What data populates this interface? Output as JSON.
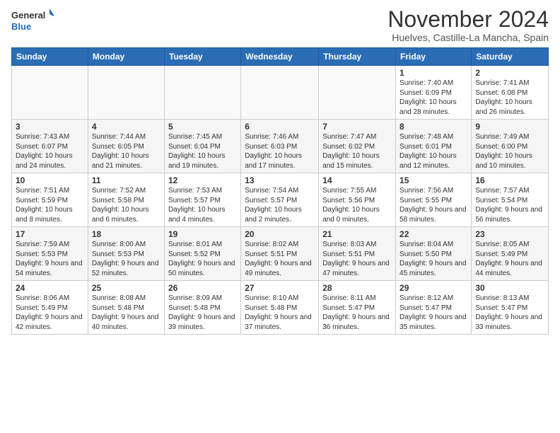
{
  "header": {
    "logo_general": "General",
    "logo_blue": "Blue",
    "month_title": "November 2024",
    "location": "Huelves, Castille-La Mancha, Spain"
  },
  "weekdays": [
    "Sunday",
    "Monday",
    "Tuesday",
    "Wednesday",
    "Thursday",
    "Friday",
    "Saturday"
  ],
  "weeks": [
    [
      {
        "day": "",
        "info": ""
      },
      {
        "day": "",
        "info": ""
      },
      {
        "day": "",
        "info": ""
      },
      {
        "day": "",
        "info": ""
      },
      {
        "day": "",
        "info": ""
      },
      {
        "day": "1",
        "info": "Sunrise: 7:40 AM\nSunset: 6:09 PM\nDaylight: 10 hours and 28 minutes."
      },
      {
        "day": "2",
        "info": "Sunrise: 7:41 AM\nSunset: 6:08 PM\nDaylight: 10 hours and 26 minutes."
      }
    ],
    [
      {
        "day": "3",
        "info": "Sunrise: 7:43 AM\nSunset: 6:07 PM\nDaylight: 10 hours and 24 minutes."
      },
      {
        "day": "4",
        "info": "Sunrise: 7:44 AM\nSunset: 6:05 PM\nDaylight: 10 hours and 21 minutes."
      },
      {
        "day": "5",
        "info": "Sunrise: 7:45 AM\nSunset: 6:04 PM\nDaylight: 10 hours and 19 minutes."
      },
      {
        "day": "6",
        "info": "Sunrise: 7:46 AM\nSunset: 6:03 PM\nDaylight: 10 hours and 17 minutes."
      },
      {
        "day": "7",
        "info": "Sunrise: 7:47 AM\nSunset: 6:02 PM\nDaylight: 10 hours and 15 minutes."
      },
      {
        "day": "8",
        "info": "Sunrise: 7:48 AM\nSunset: 6:01 PM\nDaylight: 10 hours and 12 minutes."
      },
      {
        "day": "9",
        "info": "Sunrise: 7:49 AM\nSunset: 6:00 PM\nDaylight: 10 hours and 10 minutes."
      }
    ],
    [
      {
        "day": "10",
        "info": "Sunrise: 7:51 AM\nSunset: 5:59 PM\nDaylight: 10 hours and 8 minutes."
      },
      {
        "day": "11",
        "info": "Sunrise: 7:52 AM\nSunset: 5:58 PM\nDaylight: 10 hours and 6 minutes."
      },
      {
        "day": "12",
        "info": "Sunrise: 7:53 AM\nSunset: 5:57 PM\nDaylight: 10 hours and 4 minutes."
      },
      {
        "day": "13",
        "info": "Sunrise: 7:54 AM\nSunset: 5:57 PM\nDaylight: 10 hours and 2 minutes."
      },
      {
        "day": "14",
        "info": "Sunrise: 7:55 AM\nSunset: 5:56 PM\nDaylight: 10 hours and 0 minutes."
      },
      {
        "day": "15",
        "info": "Sunrise: 7:56 AM\nSunset: 5:55 PM\nDaylight: 9 hours and 58 minutes."
      },
      {
        "day": "16",
        "info": "Sunrise: 7:57 AM\nSunset: 5:54 PM\nDaylight: 9 hours and 56 minutes."
      }
    ],
    [
      {
        "day": "17",
        "info": "Sunrise: 7:59 AM\nSunset: 5:53 PM\nDaylight: 9 hours and 54 minutes."
      },
      {
        "day": "18",
        "info": "Sunrise: 8:00 AM\nSunset: 5:53 PM\nDaylight: 9 hours and 52 minutes."
      },
      {
        "day": "19",
        "info": "Sunrise: 8:01 AM\nSunset: 5:52 PM\nDaylight: 9 hours and 50 minutes."
      },
      {
        "day": "20",
        "info": "Sunrise: 8:02 AM\nSunset: 5:51 PM\nDaylight: 9 hours and 49 minutes."
      },
      {
        "day": "21",
        "info": "Sunrise: 8:03 AM\nSunset: 5:51 PM\nDaylight: 9 hours and 47 minutes."
      },
      {
        "day": "22",
        "info": "Sunrise: 8:04 AM\nSunset: 5:50 PM\nDaylight: 9 hours and 45 minutes."
      },
      {
        "day": "23",
        "info": "Sunrise: 8:05 AM\nSunset: 5:49 PM\nDaylight: 9 hours and 44 minutes."
      }
    ],
    [
      {
        "day": "24",
        "info": "Sunrise: 8:06 AM\nSunset: 5:49 PM\nDaylight: 9 hours and 42 minutes."
      },
      {
        "day": "25",
        "info": "Sunrise: 8:08 AM\nSunset: 5:48 PM\nDaylight: 9 hours and 40 minutes."
      },
      {
        "day": "26",
        "info": "Sunrise: 8:09 AM\nSunset: 5:48 PM\nDaylight: 9 hours and 39 minutes."
      },
      {
        "day": "27",
        "info": "Sunrise: 8:10 AM\nSunset: 5:48 PM\nDaylight: 9 hours and 37 minutes."
      },
      {
        "day": "28",
        "info": "Sunrise: 8:11 AM\nSunset: 5:47 PM\nDaylight: 9 hours and 36 minutes."
      },
      {
        "day": "29",
        "info": "Sunrise: 8:12 AM\nSunset: 5:47 PM\nDaylight: 9 hours and 35 minutes."
      },
      {
        "day": "30",
        "info": "Sunrise: 8:13 AM\nSunset: 5:47 PM\nDaylight: 9 hours and 33 minutes."
      }
    ]
  ]
}
